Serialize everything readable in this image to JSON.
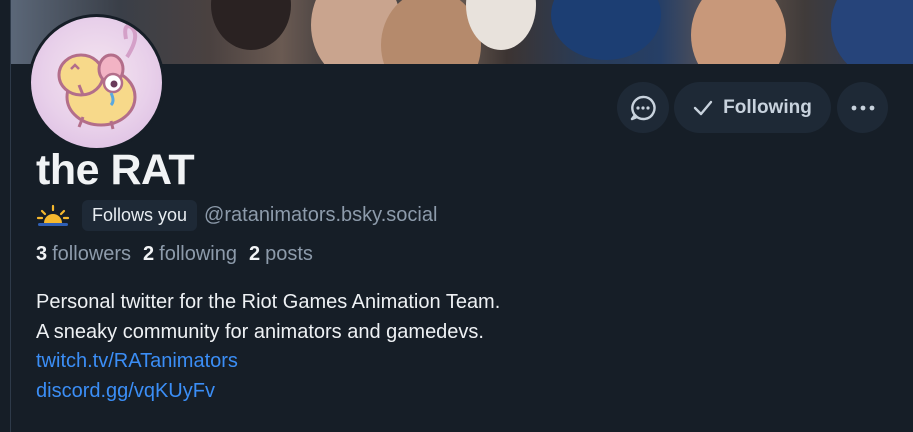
{
  "profile": {
    "display_name": "the RAT",
    "status_emoji": "sunrise-icon",
    "follows_you_badge": "Follows you",
    "handle": "@ratanimators.bsky.social",
    "stats": {
      "followers_count": "3",
      "followers_label": "followers",
      "following_count": "2",
      "following_label": "following",
      "posts_count": "2",
      "posts_label": "posts"
    },
    "bio": {
      "line1": "Personal twitter for the Riot Games Animation Team.",
      "line2": "A sneaky community for animators and gamedevs.",
      "link1": "twitch.tv/RATanimators",
      "link2": "discord.gg/vqKUyFv"
    }
  },
  "actions": {
    "message_icon": "chat-bubble-icon",
    "following_label": "Following",
    "following_icon": "checkmark-icon",
    "more_icon": "ellipsis-icon"
  },
  "colors": {
    "background": "#161e27",
    "button_bg": "#1e2936",
    "link": "#3b8ef6",
    "muted_text": "#8d9bab"
  }
}
